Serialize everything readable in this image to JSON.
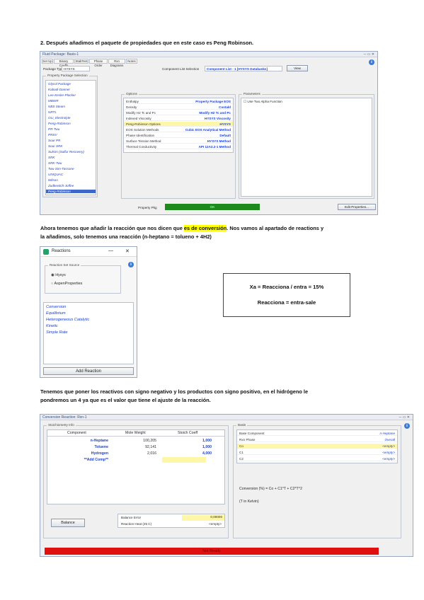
{
  "paragraphs": {
    "p1": "2. Después añadimos el paquete de propiedades que en este caso es Peng Robinson.",
    "p2_before": "Ahora tenemos que añadir la reacción que nos dicen que ",
    "p2_highlight": "es de conversión",
    "p2_after": ". Nos vamos al apartado de reactions y",
    "p2_line2": "la añadimos, solo tenemos una reacción (n-heptano = tolueno + 4H2)",
    "p3_line1": "Tenemos que poner los reactivos con signo negativo y los productos con signo positivo, en el hidrógeno le",
    "p3_line2": "pondremos un 4 ya que es el valor que tiene el ajuste de la reacción."
  },
  "fluid_package": {
    "title": "Fluid Package: Basis-1",
    "tabs": [
      "Set Up",
      "Binary Coeffs",
      "StabTest",
      "Phase Order",
      "Rxn Diagrams",
      "Notes"
    ],
    "package_type_label": "Package Type",
    "package_type_value": "HYSYS",
    "component_list_label": "Component List Selection",
    "component_list_value": "Component List - 1 [HYSYS Databanks]",
    "view_button": "View",
    "property_package_selection_label": "Property Package Selection",
    "packages": [
      "Glycol Package",
      "Kabadi-Danner",
      "Lee-Kesler-Plocker",
      "MBWR",
      "NBS Steam",
      "NRTL",
      "OLI_Electrolyte",
      "Peng-Robinson",
      "PR-Twu",
      "PRSV",
      "Sour PR",
      "Sour SRK",
      "Sulsim (Sulfur Recovery)",
      "SRK",
      "SRK-Twu",
      "Twu-Sim-Tassone",
      "UNIQUAC",
      "Wilson",
      "Zudkevitch-Joffee",
      "Peng-Robinson"
    ],
    "options_label": "Options",
    "options": [
      {
        "k": "Enthalpy",
        "v": "Property Package EOS"
      },
      {
        "k": "Density",
        "v": "Costald"
      },
      {
        "k": "Modify H2 Tc and Pc",
        "v": "Modify H2 Tc and Pc"
      },
      {
        "k": "Indexed Viscosity",
        "v": "HYSYS Viscosity"
      },
      {
        "k": "Peng-Robinson Options",
        "v": "HYSYS"
      },
      {
        "k": "EOS Solution Methods",
        "v": "Cubic EOS Analytical Method"
      },
      {
        "k": "Phase Identification",
        "v": "Default"
      },
      {
        "k": "Surface Tension Method",
        "v": "HYSYS Method"
      },
      {
        "k": "Thermal Conductivity",
        "v": "API 12A3.2-1 Method"
      }
    ],
    "parameters_label": "Parameters",
    "parameters_item": "Use Twu Alpha Function",
    "status_label": "Property Pkg",
    "status_value": "OK",
    "edit_button": "Edit Properties..."
  },
  "reactions": {
    "title": "Reactions",
    "min_btn": "—",
    "close_btn": "✕",
    "reaction_set_source_label": "Reaction Set Source",
    "radio_hysys": "Hysys",
    "radio_aspen": "AspenProperties",
    "list": [
      "Conversion",
      "Equilibrium",
      "Heterogeneous Catalytic",
      "Kinetic",
      "Simple Rate"
    ],
    "add_button": "Add Reaction"
  },
  "equations": {
    "line1": "Xa = Reacciona / entra = 15%",
    "line2": "Reacciona = entra-sale"
  },
  "conversion": {
    "title": "Conversion Reaction: Rxn-1",
    "stoich_label": "Stoichiometry Info",
    "headers": [
      "Component",
      "Mole Weight",
      "Stoich Coeff"
    ],
    "rows": [
      {
        "component": "n-Heptane",
        "mw": "100,205",
        "coeff": "1,000"
      },
      {
        "component": "Toluene",
        "mw": "92,141",
        "coeff": "1,000"
      },
      {
        "component": "Hydrogen",
        "mw": "2,016",
        "coeff": "4,000"
      },
      {
        "component": "**Add Comp**",
        "mw": "",
        "coeff": ""
      }
    ],
    "balance_button": "Balance",
    "balance_error_label": "Balance Error",
    "balance_error_value": "0,00000",
    "reaction_heat_label": "Reaction Heat (25 C)",
    "reaction_heat_value": "<empty>",
    "basis_label": "Basis",
    "basis": [
      {
        "k": "Base Component",
        "v": "n-Heptane"
      },
      {
        "k": "Rxn Phase",
        "v": "Overall"
      },
      {
        "k": "Co",
        "v": "<empty>"
      },
      {
        "k": "C1",
        "v": "<empty>"
      },
      {
        "k": "C2",
        "v": "<empty>"
      }
    ],
    "formula": "Conversion (%) = Co + C1*T + C2*T^2",
    "units": "(T in Kelvin)",
    "status": "Not Ready"
  }
}
